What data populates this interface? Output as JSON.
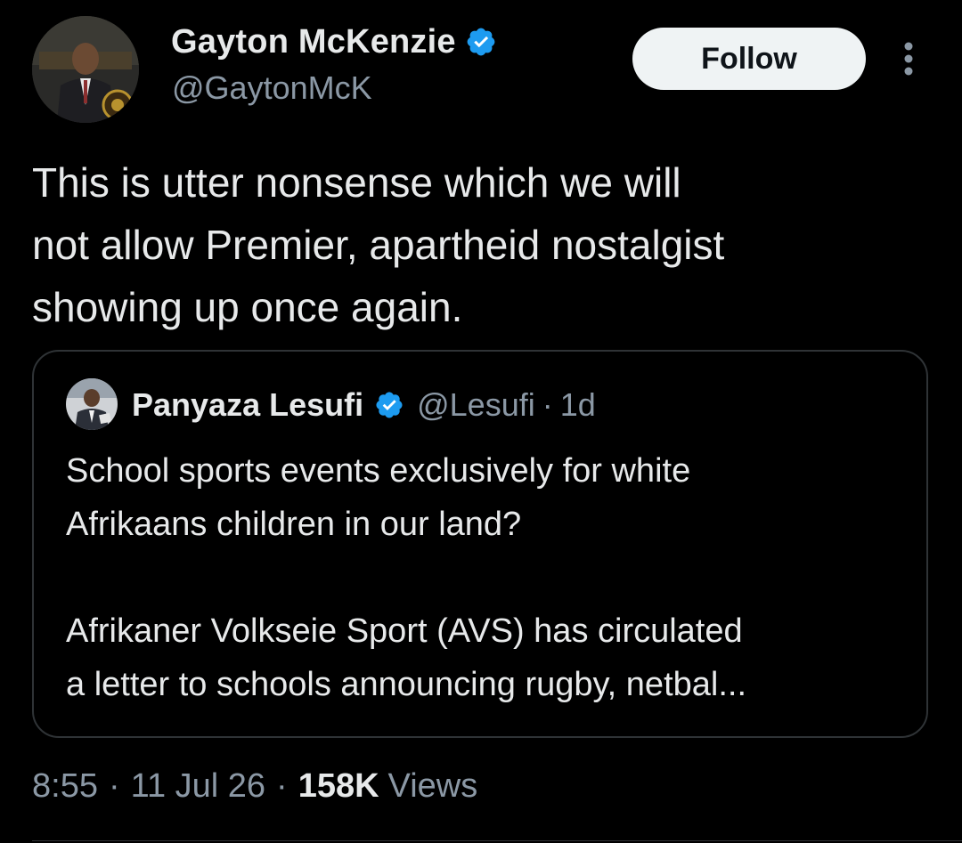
{
  "author": {
    "display_name": "Gayton McKenzie",
    "handle": "@GaytonMcK",
    "verified": true,
    "avatar_icon": "profile-photo"
  },
  "actions": {
    "follow_label": "Follow",
    "more_icon": "more-vertical-icon"
  },
  "tweet": {
    "text": "This is utter nonsense which we will\nnot allow Premier, apartheid nostalgist\nshowing up once again."
  },
  "quote": {
    "display_name": "Panyaza Lesufi",
    "handle": "@Lesufi",
    "separator": "·",
    "time": "1d",
    "verified": true,
    "avatar_icon": "profile-photo",
    "paragraph_1": "School sports events exclusively for white\nAfrikaans children in our land?",
    "paragraph_2": "Afrikaner Volkseie Sport (AVS) has circulated\na letter to schools announcing rugby, netbal..."
  },
  "meta": {
    "time": "8:55",
    "separator": "·",
    "date": "11 Jul 26",
    "views_count": "158K",
    "views_label": "Views"
  },
  "colors": {
    "background": "#000000",
    "primary_text": "#e7e9ea",
    "secondary_text": "#8b98a5",
    "verified_blue": "#1d9bf0",
    "follow_button_bg": "#eff3f4",
    "border": "#2f3336"
  }
}
